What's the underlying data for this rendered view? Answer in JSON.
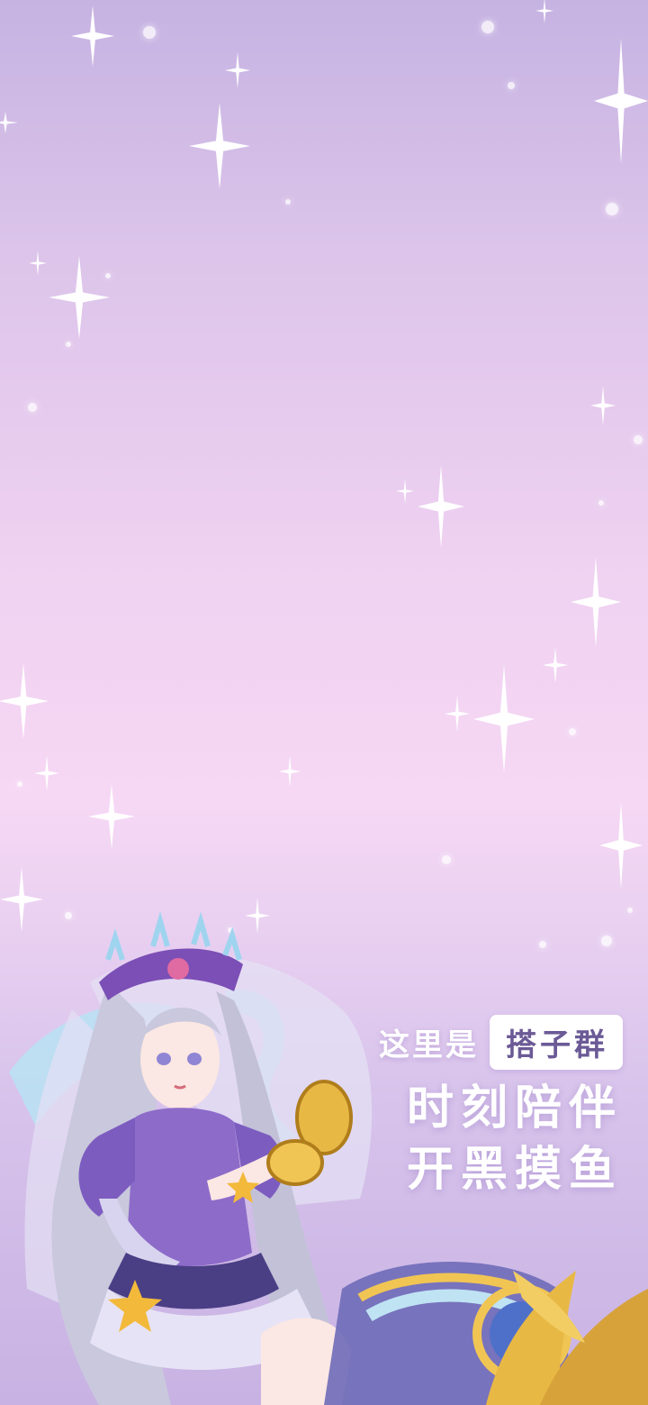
{
  "slogan": {
    "intro": "这里是",
    "highlight": "搭子群",
    "line2": "时刻陪伴",
    "line3": "开黑摸鱼"
  },
  "colors": {
    "background_top": "#c6b3e2",
    "background_mid": "#f6d8f4",
    "background_bottom": "#c8b2e3",
    "text": "#ffffff",
    "highlight_text": "#6b5a96"
  },
  "illustration": {
    "subject": "anime-girl-with-veil-and-compact-mirror"
  }
}
